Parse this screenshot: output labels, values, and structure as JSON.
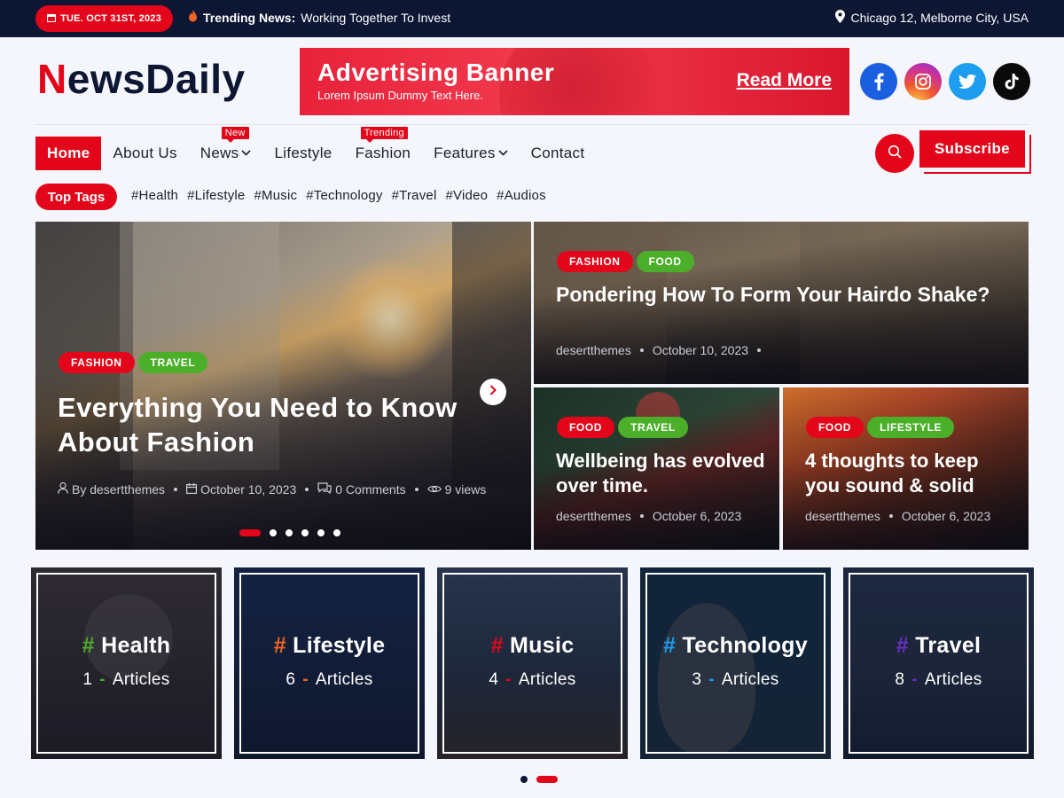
{
  "topbar": {
    "date": "TUE. OCT 31ST, 2023",
    "trending_label": "Trending News:",
    "trending_text": "Working Together To Invest",
    "location": "Chicago 12, Melborne City, USA"
  },
  "header": {
    "logo_first": "N",
    "logo_rest": "ewsDaily",
    "ad_title": "Advertising Banner",
    "ad_subtitle": "Lorem Ipsum Dummy Text Here.",
    "ad_cta": "Read More",
    "socials": [
      "facebook-icon",
      "instagram-icon",
      "twitter-icon",
      "tiktok-icon"
    ]
  },
  "nav": {
    "items": [
      {
        "label": "Home"
      },
      {
        "label": "About Us"
      },
      {
        "label": "News",
        "badge": "New"
      },
      {
        "label": "Lifestyle"
      },
      {
        "label": "Fashion",
        "badge": "Trending"
      },
      {
        "label": "Features"
      },
      {
        "label": "Contact"
      }
    ],
    "subscribe": "Subscribe"
  },
  "tags": {
    "label": "Top Tags",
    "items": [
      "#Health",
      "#Lifestyle",
      "#Music",
      "#Technology",
      "#Travel",
      "#Video",
      "#Audios"
    ]
  },
  "hero": {
    "main": {
      "badges": [
        "FASHION",
        "TRAVEL"
      ],
      "title": "Everything You Need to Know About Fashion",
      "author": "By desertthemes",
      "date": "October 10, 2023",
      "comments": "0 Comments",
      "views": "9 views"
    },
    "side": [
      {
        "badges": [
          "FASHION",
          "FOOD"
        ],
        "title": "Pondering How To Form Your Hairdo Shake?",
        "author": "desertthemes",
        "date": "October 10, 2023"
      },
      {
        "badges": [
          "FOOD",
          "TRAVEL"
        ],
        "title": "Wellbeing has evolved over time.",
        "author": "desertthemes",
        "date": "October 6, 2023"
      },
      {
        "badges": [
          "FOOD",
          "LIFESTYLE"
        ],
        "title": "4 thoughts to keep you sound & solid",
        "author": "desertthemes",
        "date": "October 6, 2023"
      }
    ]
  },
  "categories": [
    {
      "hash": "#",
      "name": "Health",
      "count": "1",
      "articles": "Articles",
      "color": "#4caf2a"
    },
    {
      "hash": "#",
      "name": "Lifestyle",
      "count": "6",
      "articles": "Articles",
      "color": "#f26522"
    },
    {
      "hash": "#",
      "name": "Music",
      "count": "4",
      "articles": "Articles",
      "color": "#e3061a"
    },
    {
      "hash": "#",
      "name": "Technology",
      "count": "3",
      "articles": "Articles",
      "color": "#1d9df0"
    },
    {
      "hash": "#",
      "name": "Travel",
      "count": "8",
      "articles": "Articles",
      "color": "#6a2fc0"
    }
  ],
  "colors": {
    "accent": "#e3061a",
    "dark": "#0d1633",
    "green": "#4caf2a"
  }
}
